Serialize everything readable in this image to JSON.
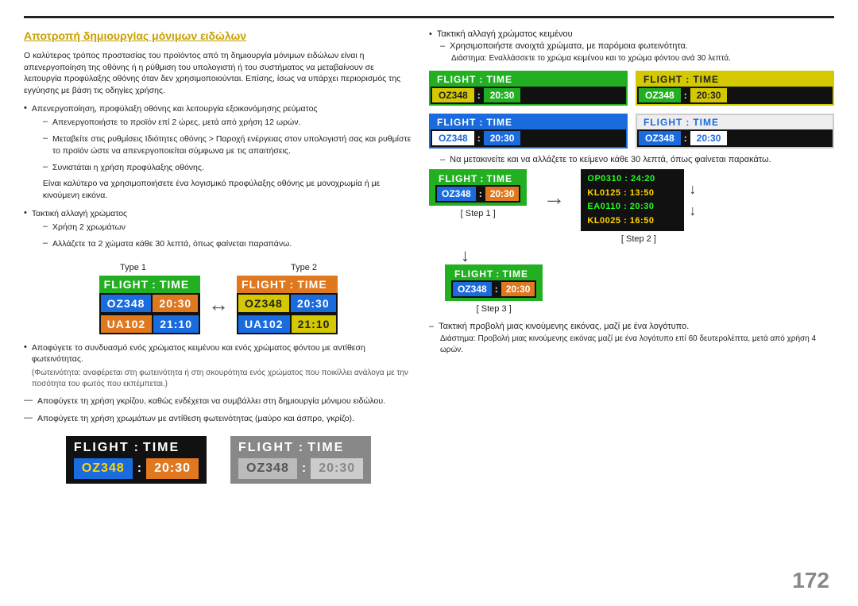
{
  "page": {
    "number": "172"
  },
  "section_title": "Αποτροπή δημιουργίας μόνιμων ειδώλων",
  "intro_text": "Ο καλύτερος τρόπος προστασίας του προϊόντος από τη δημιουργία μόνιμων ειδώλων είναι η απενεργοποίηση της οθόνης ή η ρύθμιση του υπολογιστή ή του συστήματος να μεταβαίνουν σε λειτουργία προφύλαξης οθόνης όταν δεν χρησιμοποιούνται. Επίσης, ίσως να υπάρχει περιορισμός της εγγύησης με βάση τις οδηγίες χρήσης.",
  "bullets": [
    {
      "text": "Απενεργοποίηση, προφύλαξη οθόνης και λειτουργία εξοικονόμησης ρεύματος",
      "subs": [
        "Απενεργοποιήστε το προϊόν επί 2 ώρες, μετά από χρήση 12 ωρών.",
        "Μεταβείτε στις ρυθμίσεις Ιδιότητες οθόνης > Παροχή ενέργειας στον υπολογιστή σας και ρυθμίστε το προϊόν ώστε να απενεργοποιείται σύμφωνα με τις απαιτήσεις.",
        "Συνιστάται η χρήση προφύλαξης οθόνης.",
        "Είναι καλύτερο να χρησιμοποιήσετε ένα λογισμικό προφύλαξης οθόνης με μονοχρωμία ή με κινούμενη εικόνα."
      ]
    },
    {
      "text": "Τακτική αλλαγή χρώματος",
      "subs": [
        "Χρήση 2 χρωμάτων",
        "Αλλάζετε τα 2 χώματα κάθε 30 λεπτά, όπως φαίνεται παραπάνω."
      ]
    }
  ],
  "type_labels": [
    "Type 1",
    "Type 2"
  ],
  "flight_boards_left": {
    "type1": {
      "header": {
        "col1": "FLIGHT",
        "col2": "TIME",
        "bg": "green"
      },
      "rows": [
        {
          "col1": "OZ348",
          "col2": "20:30",
          "c1bg": "blue",
          "c2bg": "orange"
        },
        {
          "col1": "UA102",
          "col2": "21:10",
          "c1bg": "orange",
          "c2bg": "blue"
        }
      ]
    },
    "type2": {
      "header": {
        "col1": "FLIGHT",
        "col2": "TIME",
        "bg": "orange"
      },
      "rows": [
        {
          "col1": "OZ348",
          "col2": "20:30",
          "c1bg": "yellow",
          "c2bg": "blue"
        },
        {
          "col1": "UA102",
          "col2": "21:10",
          "c1bg": "blue",
          "c2bg": "yellow"
        }
      ]
    }
  },
  "bottom_warning1": "Αποφύγετε το συνδυασμό ενός χρώματος κειμένου και ενός χρώματος φόντου με αντίθεση φωτεινότητας.",
  "bottom_warning1b": "(Φωτεινότητα: αναφέρεται στη φωτεινότητα ή στη σκουρότητα ενός χρώματος που ποικίλλει ανάλογα με την ποσότητα του φωτός που εκπέμπεται.)",
  "dash_warning2": "Αποφύγετε τη χρήση γκρίζου, καθώς ενδέχεται να συμβάλλει στη δημιουργία μόνιμου ειδώλου.",
  "dash_warning3": "Αποφύγετε τη χρήση χρωμάτων με αντίθεση φωτεινότητας (μαύρο και άσπρο, γκρίζο).",
  "bottom_boards": [
    {
      "header1": "FLIGHT",
      "header2": "TIME",
      "cell1": "OZ348",
      "cell2": "20:30",
      "style": "dark"
    },
    {
      "header1": "FLIGHT",
      "header2": "TIME",
      "cell1": "OZ348",
      "cell2": "20:30",
      "style": "gray"
    }
  ],
  "right_col": {
    "bullet1": "Τακτική αλλαγή χρώματος κειμένου",
    "sub1": "Χρησιμοποιήστε ανοιχτά χρώματα, με παρόμοια φωτεινότητα.",
    "sub2": "Διάστημα: Εναλλάσσετε το χρώμα κειμένου και το χρώμα φόντου ανά 30 λεπτά.",
    "right_boards": [
      {
        "h1": "FLIGHT",
        "h2": "TIME",
        "c1": "OZ348",
        "c2": "20:30",
        "style": "green_yellow"
      },
      {
        "h1": "FLIGHT",
        "h2": "TIME",
        "c1": "OZ348",
        "c2": "20:30",
        "style": "yellow_green"
      },
      {
        "h1": "FLIGHT",
        "h2": "TIME",
        "c1": "OZ348",
        "c2": "20:30",
        "style": "blue_white"
      },
      {
        "h1": "FLIGHT",
        "h2": "TIME",
        "c1": "OZ348",
        "c2": "20:30",
        "style": "white_blue"
      }
    ],
    "step_text": "Να μετακινείτε και να αλλάζετε το κείμενο κάθε 30 λεπτά, όπως φαίνεται παρακάτω.",
    "step1_label": "[ Step 1 ]",
    "step2_label": "[ Step 2 ]",
    "step3_label": "[ Step 3 ]",
    "step1_board": {
      "h1": "FLIGHT",
      "h2": "TIME",
      "c1": "OZ348",
      "c2": "20:30"
    },
    "step2_lines": [
      "OP0310 : 24:20",
      "KL0125 : 13:50",
      "EA0110 : 20:30",
      "KL0025 : 16:50"
    ],
    "step3_board": {
      "h1": "FLIGHT",
      "h2": "TIME",
      "c1": "OZ348",
      "c2": "20:30"
    },
    "bullet2": "Τακτική προβολή μιας κινούμενης εικόνας, μαζί με ένα λογότυπο.",
    "sub3": "Διάστημα: Προβολή μιας κινούμενης εικόνας μαζί με ένα λογότυπο επί 60 δευτερολέπτα, μετά από χρήση 4 ωρών."
  }
}
